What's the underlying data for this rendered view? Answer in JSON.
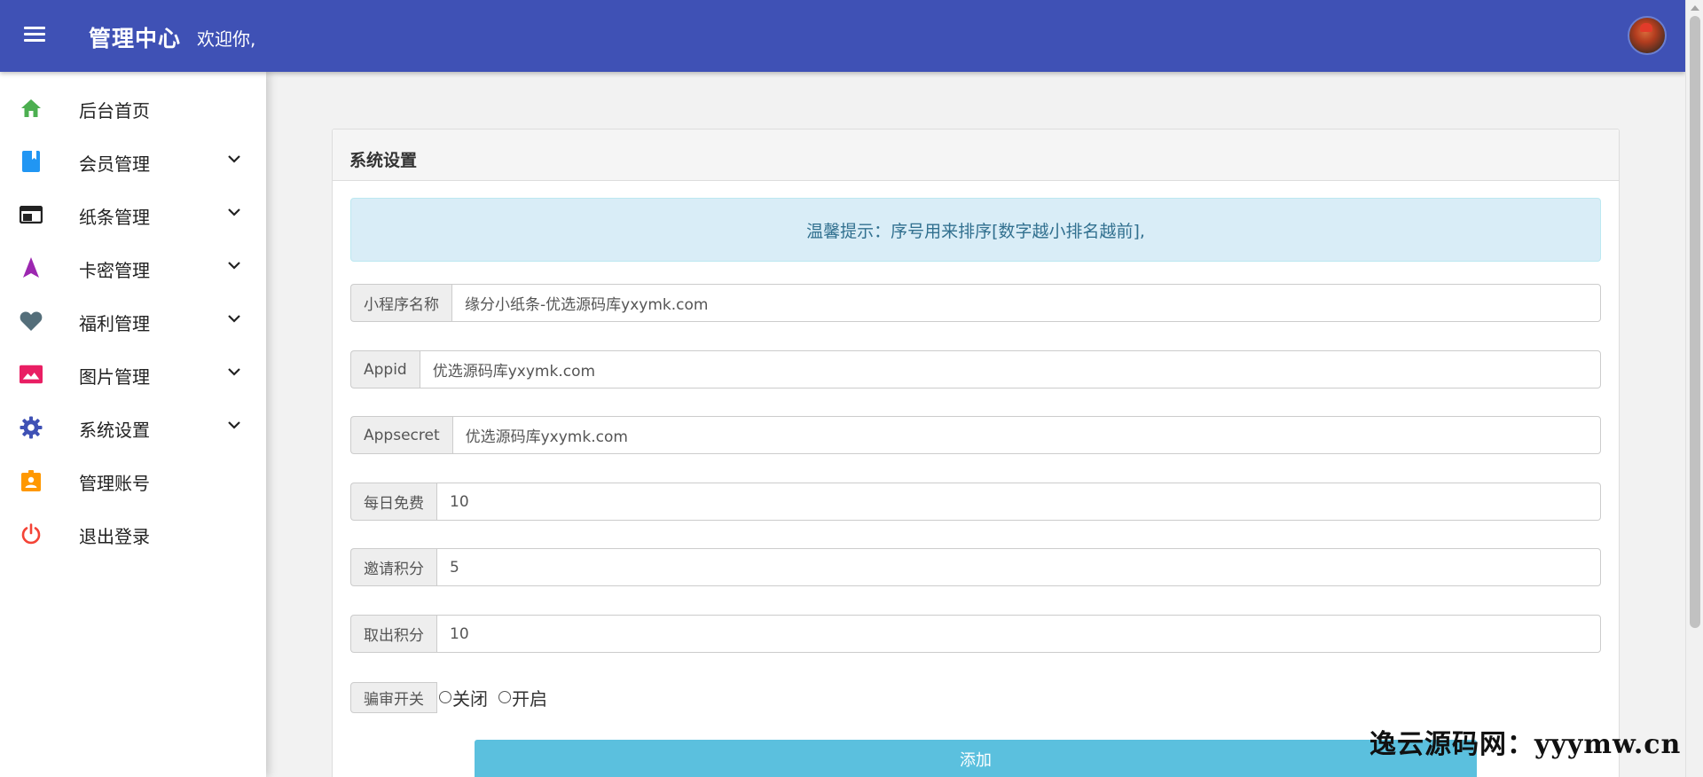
{
  "header": {
    "title": "管理中心",
    "welcome": "欢迎你,",
    "bg_color": "#3f51b5"
  },
  "sidebar": {
    "items": [
      {
        "label": "后台首页",
        "icon": "home-icon",
        "color": "#4caf50",
        "expandable": false
      },
      {
        "label": "会员管理",
        "icon": "book-icon",
        "color": "#2196f3",
        "expandable": true
      },
      {
        "label": "纸条管理",
        "icon": "web-window-icon",
        "color": "#222222",
        "expandable": true
      },
      {
        "label": "卡密管理",
        "icon": "navigation-arrow-icon",
        "color": "#9c27b0",
        "expandable": true
      },
      {
        "label": "福利管理",
        "icon": "heart-icon",
        "color": "#546e7a",
        "expandable": true
      },
      {
        "label": "图片管理",
        "icon": "image-icon",
        "color": "#e91e63",
        "expandable": true
      },
      {
        "label": "系统设置",
        "icon": "gear-icon",
        "color": "#3f51b5",
        "expandable": true
      },
      {
        "label": "管理账号",
        "icon": "badge-icon",
        "color": "#ff9800",
        "expandable": false
      },
      {
        "label": "退出登录",
        "icon": "power-icon",
        "color": "#f44336",
        "expandable": false
      }
    ]
  },
  "main": {
    "card_title": "系统设置",
    "tip": "温馨提示：序号用来排序[数字越小排名越前],",
    "fields": [
      {
        "label": "小程序名称",
        "value": "缘分小纸条-优选源码库yxymk.com"
      },
      {
        "label": "Appid",
        "value": "优选源码库yxymk.com"
      },
      {
        "label": "Appsecret",
        "value": "优选源码库yxymk.com"
      },
      {
        "label": "每日免费",
        "value": "10"
      },
      {
        "label": "邀请积分",
        "value": "5"
      },
      {
        "label": "取出积分",
        "value": "10"
      }
    ],
    "switch": {
      "label": "骗审开关",
      "options": [
        "关闭",
        " 开启"
      ]
    },
    "add_button": "添加"
  },
  "watermark": "逸云源码网：yyymw.cn",
  "colors": {
    "accent": "#3f51b5",
    "tip_bg": "#d9edf7",
    "tip_text": "#31708f",
    "button": "#5bc0de"
  }
}
